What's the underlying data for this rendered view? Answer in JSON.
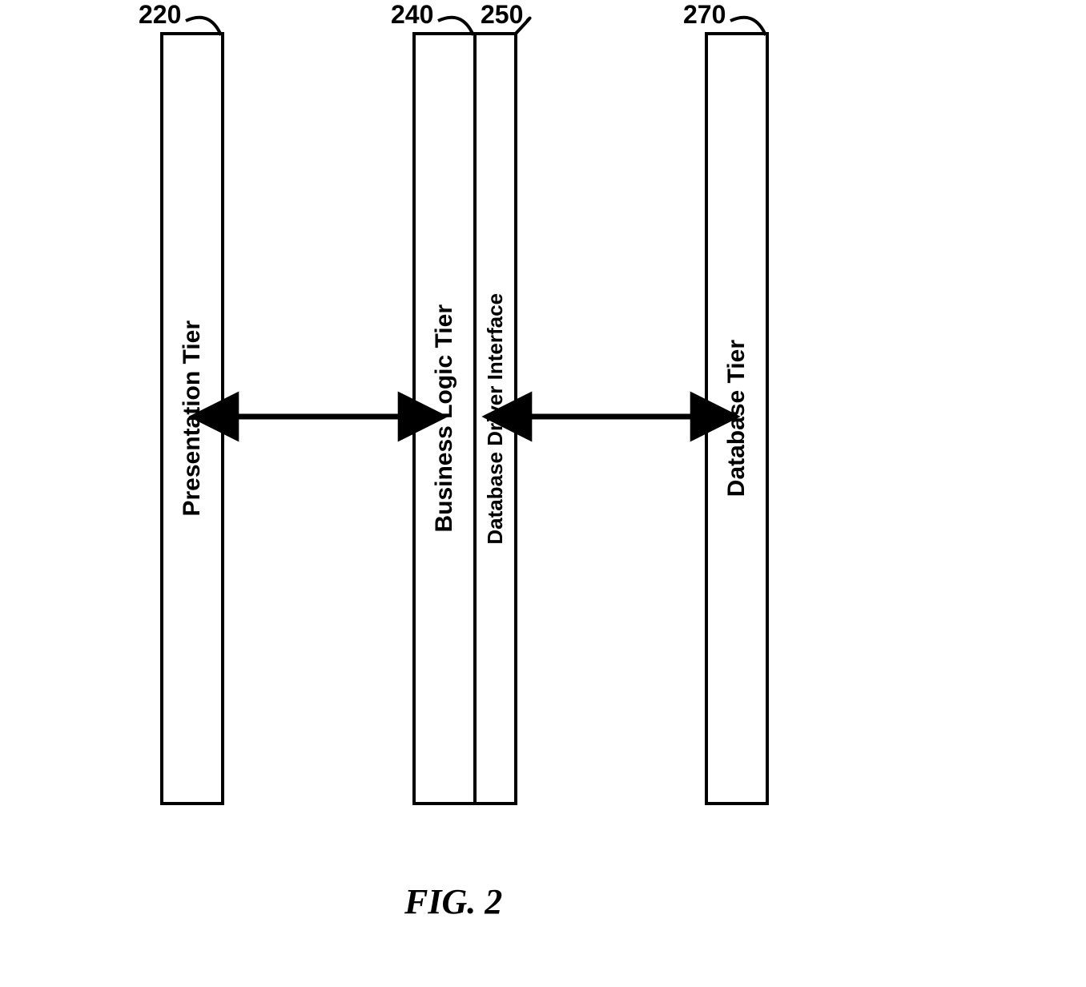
{
  "figure_caption": "FIG. 2",
  "boxes": {
    "presentation": {
      "label": "Presentation Tier",
      "ref": "220"
    },
    "business": {
      "label": "Business Logic Tier",
      "ref": "240"
    },
    "driver": {
      "label": "Database Driver Interface",
      "ref": "250"
    },
    "database": {
      "label": "Database Tier",
      "ref": "270"
    }
  }
}
